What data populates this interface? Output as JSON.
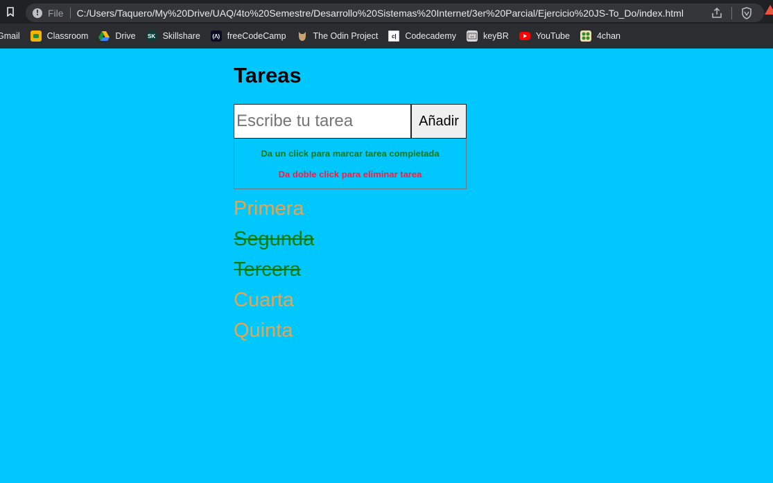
{
  "browser": {
    "scheme": "File",
    "url": "C:/Users/Taquero/My%20Drive/UAQ/4to%20Semestre/Desarrollo%20Sistemas%20Internet/3er%20Parcial/Ejercicio%20JS-To_Do/index.html",
    "extension_badge": "2"
  },
  "bookmarks": [
    {
      "label": "Gmail",
      "icon": "gmail-icon"
    },
    {
      "label": "Classroom",
      "icon": "classroom-icon"
    },
    {
      "label": "Drive",
      "icon": "drive-icon"
    },
    {
      "label": "Skillshare",
      "icon": "skillshare-icon"
    },
    {
      "label": "freeCodeCamp",
      "icon": "freecodecamp-icon"
    },
    {
      "label": "The Odin Project",
      "icon": "odin-icon"
    },
    {
      "label": "Codecademy",
      "icon": "codecademy-icon"
    },
    {
      "label": "keyBR",
      "icon": "keybr-icon"
    },
    {
      "label": "YouTube",
      "icon": "youtube-icon"
    },
    {
      "label": "4chan",
      "icon": "4chan-icon"
    }
  ],
  "app": {
    "title": "Tareas",
    "input_placeholder": "Escribe tu tarea",
    "add_label": "Añadir",
    "hint_complete": "Da un click para marcar tarea completada",
    "hint_delete": "Da doble click para eliminar tarea",
    "tasks": [
      {
        "text": "Primera",
        "done": false
      },
      {
        "text": "Segunda",
        "done": true
      },
      {
        "text": "Tercera",
        "done": true
      },
      {
        "text": "Cuarta",
        "done": false
      },
      {
        "text": "Quinta",
        "done": false
      }
    ]
  },
  "colors": {
    "background": "#00c8ff",
    "pending_task": "#e6a44e",
    "done_task": "#0b7a12",
    "delete_hint": "#ff1a3c"
  }
}
